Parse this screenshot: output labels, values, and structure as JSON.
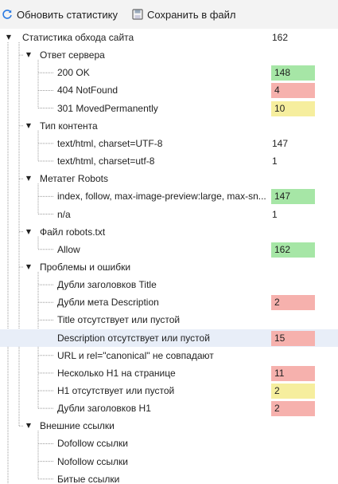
{
  "toolbar": {
    "refresh_label": "Обновить статистику",
    "save_label": "Сохранить в файл"
  },
  "tree": {
    "root": {
      "label": "Статистика обхода сайта",
      "value": "162"
    },
    "groups": [
      {
        "label": "Ответ сервера",
        "items": [
          {
            "label": "200 OK",
            "value": "148",
            "status": "good"
          },
          {
            "label": "404 NotFound",
            "value": "4",
            "status": "bad"
          },
          {
            "label": "301 MovedPermanently",
            "value": "10",
            "status": "warn"
          }
        ]
      },
      {
        "label": "Тип контента",
        "items": [
          {
            "label": "text/html, charset=UTF-8",
            "value": "147",
            "status": ""
          },
          {
            "label": "text/html, charset=utf-8",
            "value": "1",
            "status": ""
          }
        ]
      },
      {
        "label": "Метатег Robots",
        "items": [
          {
            "label": "index, follow, max-image-preview:large, max-sn...",
            "value": "147",
            "status": "good"
          },
          {
            "label": "n/a",
            "value": "1",
            "status": ""
          }
        ]
      },
      {
        "label": "Файл robots.txt",
        "items": [
          {
            "label": "Allow",
            "value": "162",
            "status": "good"
          }
        ]
      },
      {
        "label": "Проблемы и ошибки",
        "items": [
          {
            "label": "Дубли заголовков Title",
            "value": "",
            "status": ""
          },
          {
            "label": "Дубли мета Description",
            "value": "2",
            "status": "bad"
          },
          {
            "label": "Title отсутствует или пустой",
            "value": "",
            "status": ""
          },
          {
            "label": "Description отсутствует или пустой",
            "value": "15",
            "status": "bad",
            "selected": true
          },
          {
            "label": "URL и rel=\"canonical\" не совпадают",
            "value": "",
            "status": ""
          },
          {
            "label": "Несколько H1 на странице",
            "value": "11",
            "status": "bad"
          },
          {
            "label": "H1 отсутствует или пустой",
            "value": "2",
            "status": "warn"
          },
          {
            "label": "Дубли заголовков H1",
            "value": "2",
            "status": "bad"
          }
        ]
      },
      {
        "label": "Внешние ссылки",
        "items": [
          {
            "label": "Dofollow ссылки",
            "value": "",
            "status": ""
          },
          {
            "label": "Nofollow ссылки",
            "value": "",
            "status": ""
          },
          {
            "label": "Битые ссылки",
            "value": "",
            "status": ""
          }
        ]
      }
    ]
  },
  "colors": {
    "good": "#a6e6a6",
    "bad": "#f6b1ad",
    "warn": "#f6ee9e",
    "selected": "#e8eef8"
  }
}
